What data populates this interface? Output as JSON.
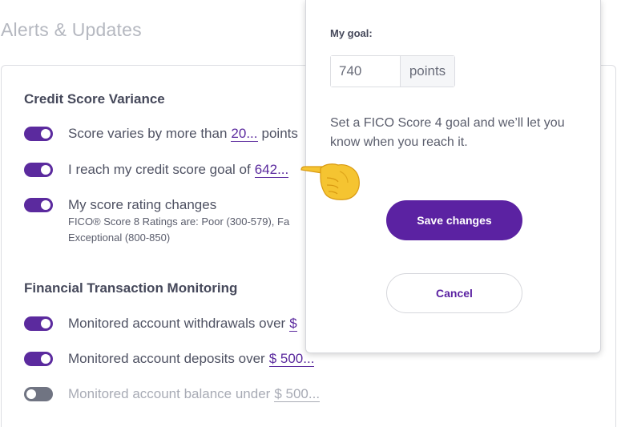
{
  "page": {
    "title": "Alerts & Updates"
  },
  "sections": {
    "credit": {
      "heading": "Credit Score Variance",
      "rows": [
        {
          "text": "Score varies by more than",
          "link": "20...",
          "tail": "points",
          "on": true
        },
        {
          "text": "I reach my credit score goal of",
          "link": "642...",
          "on": true
        },
        {
          "text": "My score rating changes",
          "on": true,
          "sub_line1": "FICO® Score 8 Ratings are:  Poor (300-579), Fa",
          "sub_line2": "Exceptional (800-850)"
        }
      ]
    },
    "financial": {
      "heading": "Financial Transaction Monitoring",
      "rows": [
        {
          "text": "Monitored account withdrawals over",
          "link": "$",
          "on": true
        },
        {
          "text": "Monitored account deposits over",
          "link": "$ 500...",
          "on": true
        },
        {
          "text": "Monitored account balance under",
          "link": "$ 500...",
          "on": false
        }
      ]
    }
  },
  "popover": {
    "label": "My goal:",
    "goal_value": "740",
    "unit": "points",
    "description": "Set a FICO Score 4 goal and we’ll let you know when you reach it.",
    "save_label": "Save changes",
    "cancel_label": "Cancel"
  },
  "colors": {
    "accent": "#5b22a2",
    "toggle_off": "#707482",
    "hand": "#f5c431"
  },
  "icons": {
    "pointer": "pointing-hand-icon"
  }
}
